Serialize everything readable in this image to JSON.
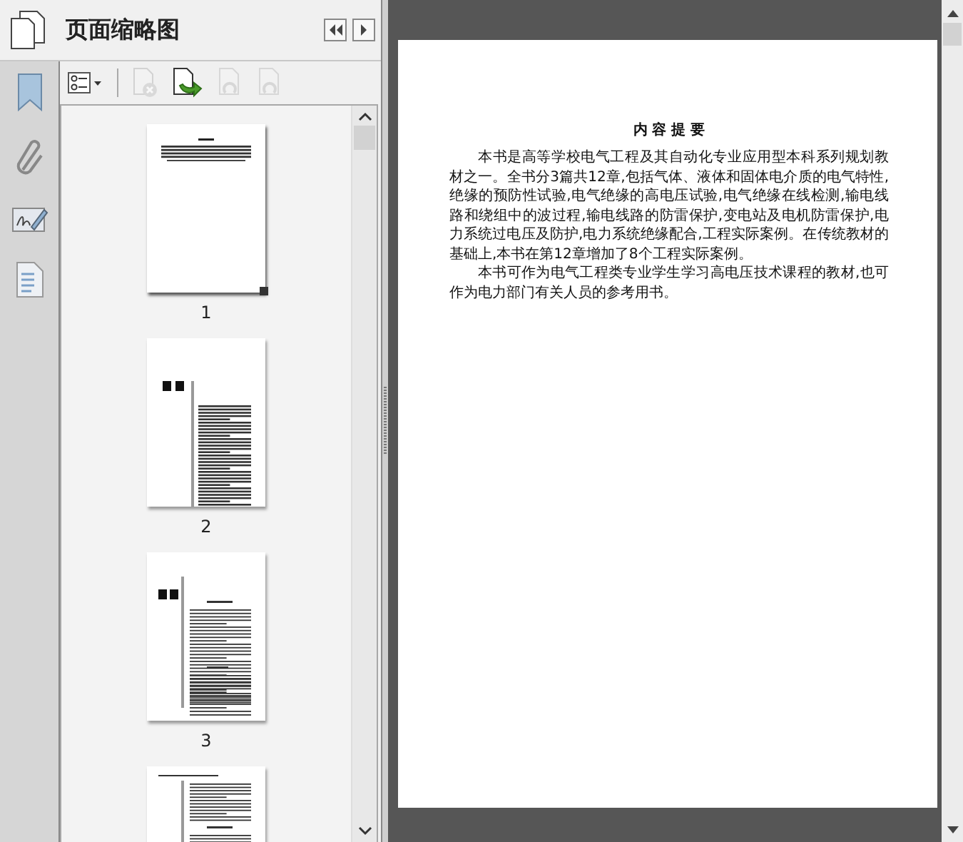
{
  "panel": {
    "title": "页面缩略图",
    "toolbar": [
      {
        "kind": "options",
        "disabled": false
      },
      {
        "kind": "delete",
        "disabled": true
      },
      {
        "kind": "insert",
        "disabled": false
      },
      {
        "kind": "undo",
        "disabled": true
      },
      {
        "kind": "redo",
        "disabled": true
      }
    ],
    "thumbnails": [
      {
        "kind": "abstract",
        "label": "1",
        "selected": true
      },
      {
        "kind": "preface",
        "label": "2",
        "selected": false
      },
      {
        "kind": "contents",
        "label": "3",
        "selected": false
      },
      {
        "kind": "contents-continued",
        "selected": false
      }
    ]
  },
  "document": {
    "heading": "内 容 提 要",
    "paragraphs": [
      "本书是高等学校电气工程及其自动化专业应用型本科系列规划教材之一。全书分3篇共12章,包括气体、液体和固体电介质的电气特性,绝缘的预防性试验,电气绝缘的高电压试验,电气绝缘在线检测,输电线路和绕组中的波过程,输电线路的防雷保护,变电站及电机防雷保护,电力系统过电压及防护,电力系统绝缘配合,工程实际案例。在传统教材的基础上,本书在第12章增加了8个工程实际案例。",
      "本书可作为电气工程类专业学生学习高电压技术课程的教材,也可作为电力部门有关人员的参考用书。"
    ]
  }
}
